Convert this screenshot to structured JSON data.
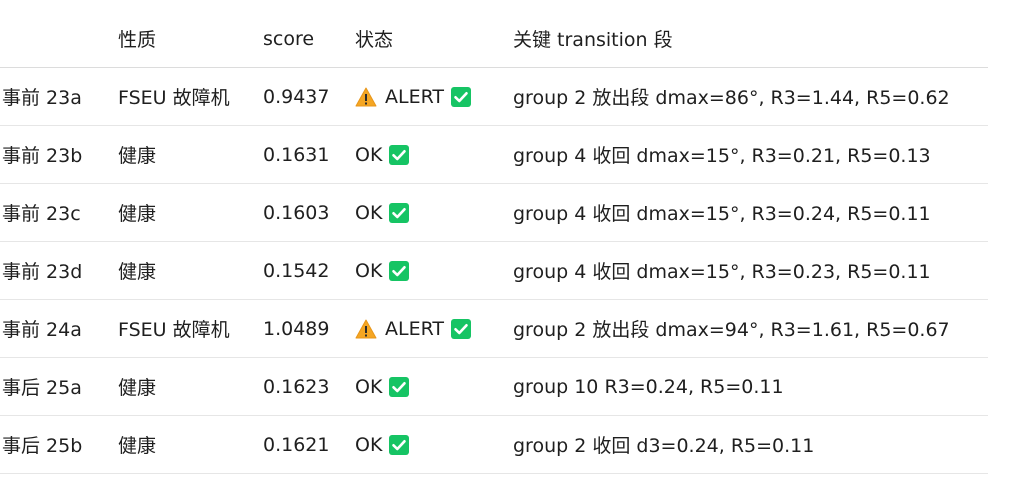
{
  "header": {
    "col_name": "",
    "col_type": "性质",
    "col_score": "score",
    "col_status": "状态",
    "col_transition": "关键 transition 段"
  },
  "rows": [
    {
      "name": "事前 23a",
      "type": "FSEU 故障机",
      "score": "0.9437",
      "status": "ALERT",
      "alert": true,
      "transition": "group 2 放出段 dmax=86°, R3=1.44, R5=0.62"
    },
    {
      "name": "事前 23b",
      "type": "健康",
      "score": "0.1631",
      "status": "OK",
      "alert": false,
      "transition": "group 4 收回 dmax=15°, R3=0.21, R5=0.13"
    },
    {
      "name": "事前 23c",
      "type": "健康",
      "score": "0.1603",
      "status": "OK",
      "alert": false,
      "transition": "group 4 收回 dmax=15°, R3=0.24, R5=0.11"
    },
    {
      "name": "事前 23d",
      "type": "健康",
      "score": "0.1542",
      "status": "OK",
      "alert": false,
      "transition": "group 4 收回 dmax=15°, R3=0.23, R5=0.11"
    },
    {
      "name": "事前 24a",
      "type": "FSEU 故障机",
      "score": "1.0489",
      "status": "ALERT",
      "alert": true,
      "transition": "group 2 放出段 dmax=94°, R3=1.61, R5=0.67"
    },
    {
      "name": "事后 25a",
      "type": "健康",
      "score": "0.1623",
      "status": "OK",
      "alert": false,
      "transition": "group 10 R3=0.24, R5=0.11"
    },
    {
      "name": "事后 25b",
      "type": "健康",
      "score": "0.1621",
      "status": "OK",
      "alert": false,
      "transition": "group 2 收回 d3=0.24, R5=0.11"
    }
  ],
  "colors": {
    "check_green": "#16c464",
    "warn_orange": "#f5a623"
  }
}
